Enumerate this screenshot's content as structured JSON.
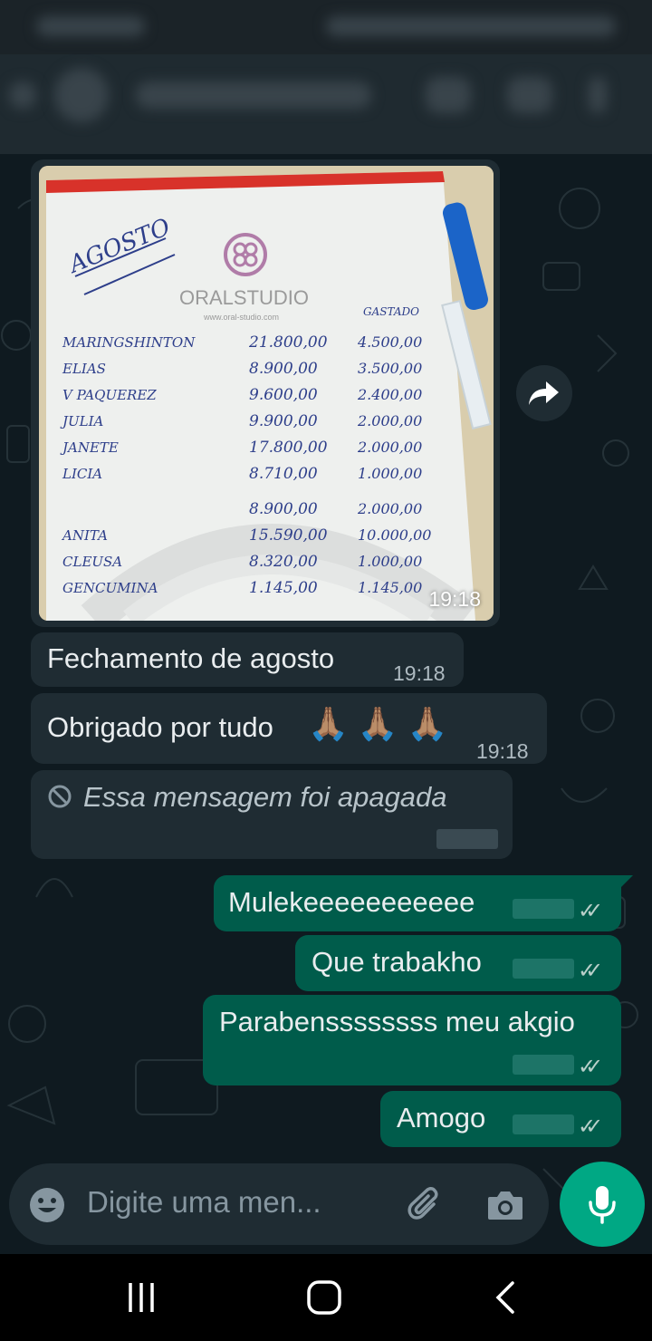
{
  "messages": {
    "photo_time": "19:18",
    "fechamento": {
      "text": "Fechamento de agosto",
      "time": "19:18"
    },
    "obrigado": {
      "text": "Obrigado por tudo",
      "emoji": "🙏🏽 🙏🏽 🙏🏽",
      "time": "19:18"
    },
    "deleted": {
      "text": "Essa mensagem foi apagada"
    },
    "out1": {
      "text": "Mulekeeeeeeeeeee"
    },
    "out2": {
      "text": "Que trabakho"
    },
    "out3": {
      "text": "Parabenssssssss meu akgio"
    },
    "out4": {
      "text": "Amogo"
    }
  },
  "photo_sheet": {
    "month": "AGOSTO",
    "brand": "ORALSTUDIO",
    "site": "www.oral-studio.com",
    "gastos_header": "GASTADO",
    "rows": [
      {
        "name": "MARINGSHINTON",
        "value": "21.800,00",
        "gasto": "4.500,00"
      },
      {
        "name": "ELIAS",
        "value": "8.900,00",
        "gasto": "3.500,00"
      },
      {
        "name": "V PAQUEREZ",
        "value": "9.600,00",
        "gasto": "2.400,00"
      },
      {
        "name": "JULIA",
        "value": "9.900,00",
        "gasto": "2.000,00"
      },
      {
        "name": "JANETE",
        "value": "17.800,00",
        "gasto": "2.000,00"
      },
      {
        "name": "LICIA",
        "value": "8.710,00",
        "gasto": "1.000,00"
      },
      {
        "name": "",
        "value": "8.900,00",
        "gasto": "2.000,00"
      },
      {
        "name": "ANITA",
        "value": "15.590,00",
        "gasto": "10.000,00"
      },
      {
        "name": "CLEUSA",
        "value": "8.320,00",
        "gasto": "1.000,00"
      },
      {
        "name": "GENCUMINA",
        "value": "1.145,00",
        "gasto": "1.145,00"
      }
    ]
  },
  "input": {
    "placeholder": "Digite uma men..."
  },
  "icons": [
    "forward-icon",
    "deleted-icon",
    "emoji-icon",
    "attach-icon",
    "camera-icon",
    "mic-icon",
    "recents-icon",
    "home-icon",
    "back-icon"
  ],
  "colors": {
    "incoming": "#1f2c33",
    "outgoing": "#005c4b",
    "accent": "#00a884",
    "background": "#0b141a"
  }
}
